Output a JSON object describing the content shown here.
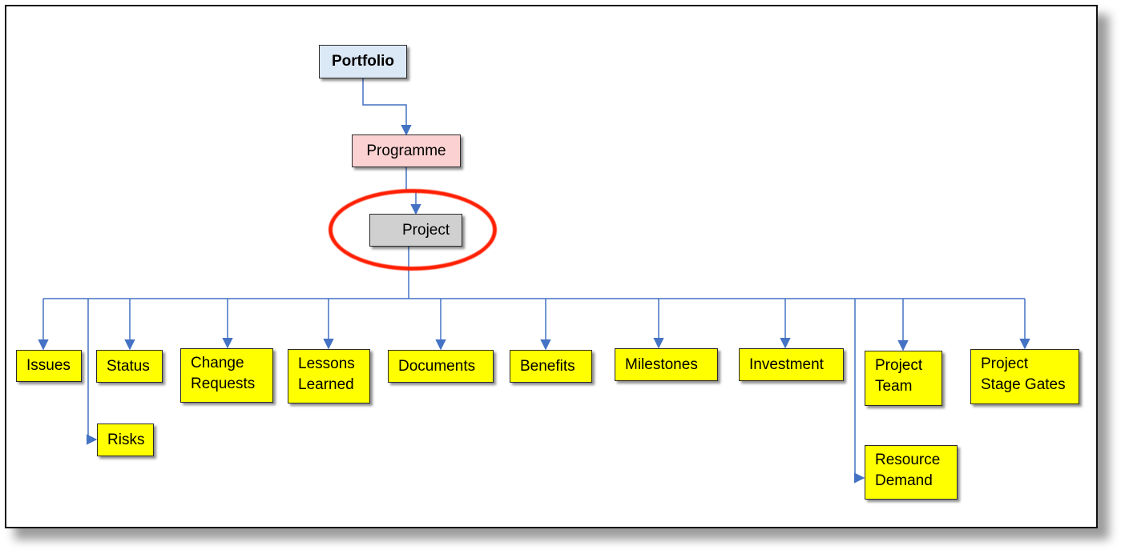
{
  "colors": {
    "connector": "#4472c4",
    "portfolio_fill": "#dbe8f6",
    "programme_fill": "#fcd1d1",
    "project_fill": "#d0d0d0",
    "leaf_fill": "#ffff00",
    "highlight_ring": "#ff1e00"
  },
  "hierarchy": {
    "portfolio": "Portfolio",
    "programme": "Programme",
    "project": "Project",
    "highlighted": "Project",
    "children": [
      {
        "id": "issues",
        "lines": [
          "Issues"
        ]
      },
      {
        "id": "risks",
        "lines": [
          "Risks"
        ]
      },
      {
        "id": "status",
        "lines": [
          "Status"
        ]
      },
      {
        "id": "change-requests",
        "lines": [
          "Change",
          "Requests"
        ]
      },
      {
        "id": "lessons-learned",
        "lines": [
          "Lessons",
          "Learned"
        ]
      },
      {
        "id": "documents",
        "lines": [
          "Documents"
        ]
      },
      {
        "id": "benefits",
        "lines": [
          "Benefits"
        ]
      },
      {
        "id": "milestones",
        "lines": [
          "Milestones"
        ]
      },
      {
        "id": "investment",
        "lines": [
          "Investment"
        ]
      },
      {
        "id": "resource-demand",
        "lines": [
          "Resource",
          "Demand"
        ]
      },
      {
        "id": "project-team",
        "lines": [
          "Project",
          "Team"
        ]
      },
      {
        "id": "project-stage-gates",
        "lines": [
          "Project",
          "Stage Gates"
        ]
      }
    ]
  }
}
